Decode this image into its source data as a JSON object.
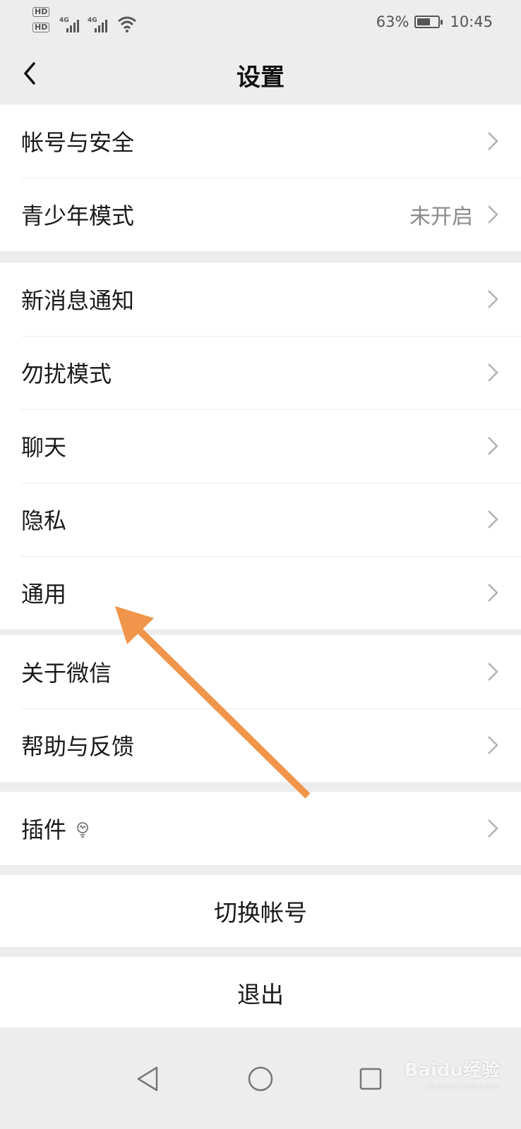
{
  "status_bar": {
    "hd1": "HD",
    "hd2": "HD",
    "net1": "4G",
    "net2": "4G",
    "battery_percent": "63%",
    "battery_level": 0.63,
    "time": "10:45"
  },
  "nav": {
    "title": "设置"
  },
  "groups": [
    {
      "items": [
        {
          "label": "帐号与安全"
        },
        {
          "label": "青少年模式",
          "value": "未开启"
        }
      ]
    },
    {
      "items": [
        {
          "label": "新消息通知"
        },
        {
          "label": "勿扰模式"
        },
        {
          "label": "聊天"
        },
        {
          "label": "隐私"
        },
        {
          "label": "通用"
        }
      ]
    },
    {
      "items": [
        {
          "label": "关于微信"
        },
        {
          "label": "帮助与反馈"
        }
      ]
    },
    {
      "items": [
        {
          "label": "插件"
        }
      ]
    }
  ],
  "buttons": {
    "switch_account": "切换帐号",
    "logout": "退出"
  },
  "icons": {
    "back": "chevron-left-icon",
    "row_arrow": "chevron-right-icon",
    "plugin": "lightbulb-icon",
    "nav_back": "triangle-back-icon",
    "nav_home": "circle-home-icon",
    "nav_recent": "square-recent-icon"
  },
  "watermark": {
    "text": "Baidu经验",
    "sub": "jingyan.baidu.com"
  },
  "colors": {
    "background": "#ededed",
    "annotation_arrow": "#f0954a",
    "secondary_text": "#8a8a8a"
  }
}
